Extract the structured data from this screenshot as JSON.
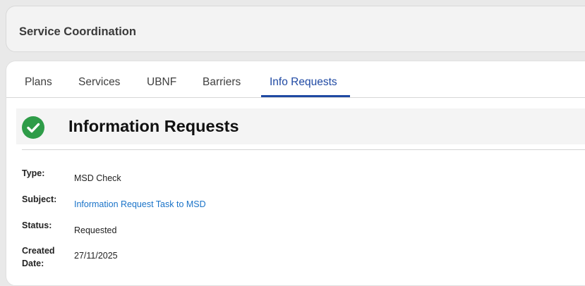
{
  "header": {
    "title": "Service Coordination"
  },
  "tabs": [
    {
      "label": "Plans",
      "active": false
    },
    {
      "label": "Services",
      "active": false
    },
    {
      "label": "UBNF",
      "active": false
    },
    {
      "label": "Barriers",
      "active": false
    },
    {
      "label": "Info Requests",
      "active": true
    }
  ],
  "section": {
    "icon": "check-circle-icon",
    "title": "Information Requests"
  },
  "fields": [
    {
      "label": "Type:",
      "value": "MSD Check"
    },
    {
      "label": "Subject:",
      "value": "Information Request Task to MSD",
      "is_link": true
    },
    {
      "label": "Status:",
      "value": "Requested"
    },
    {
      "label": "Created\nDate:",
      "value": "27/11/2025"
    }
  ],
  "colors": {
    "accent": "#1f49a3",
    "success": "#2e9c48",
    "link": "#1a73c8"
  }
}
